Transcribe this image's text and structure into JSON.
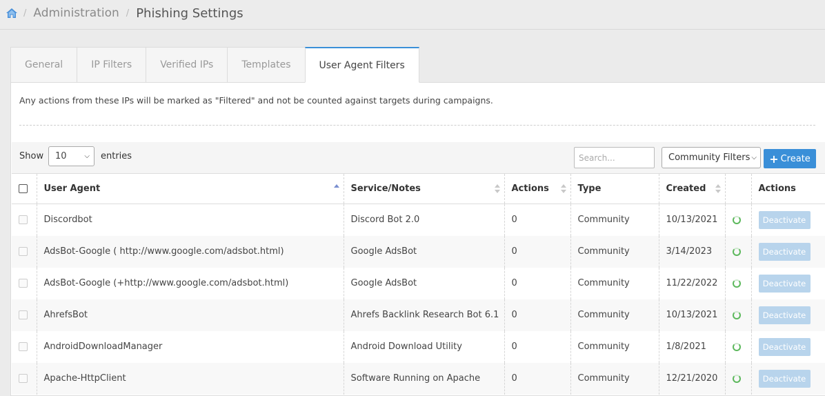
{
  "breadcrumb": {
    "parent": "Administration",
    "title": "Phishing Settings"
  },
  "tabs": [
    {
      "label": "General"
    },
    {
      "label": "IP Filters"
    },
    {
      "label": "Verified IPs"
    },
    {
      "label": "Templates"
    },
    {
      "label": "User Agent Filters",
      "active": true
    }
  ],
  "notice": "Any actions from these IPs will be marked as \"Filtered\" and not be counted against targets during campaigns.",
  "toolbar": {
    "show_label": "Show",
    "entries_value": "10",
    "entries_label": "entries",
    "search_placeholder": "Search...",
    "filter_value": "Community Filters",
    "create_label": "Create"
  },
  "table": {
    "columns": [
      "User Agent",
      "Service/Notes",
      "Actions",
      "Type",
      "Created",
      "",
      "Actions"
    ],
    "rows": [
      {
        "agent": "Discordbot",
        "service": "Discord Bot 2.0",
        "actions": "0",
        "type": "Community",
        "created": "10/13/2021",
        "button": "Deactivate"
      },
      {
        "agent": "AdsBot-Google ( http://www.google.com/adsbot.html)",
        "service": "Google AdsBot",
        "actions": "0",
        "type": "Community",
        "created": "3/14/2023",
        "button": "Deactivate"
      },
      {
        "agent": "AdsBot-Google (+http://www.google.com/adsbot.html)",
        "service": "Google AdsBot",
        "actions": "0",
        "type": "Community",
        "created": "11/22/2022",
        "button": "Deactivate"
      },
      {
        "agent": "AhrefsBot",
        "service": "Ahrefs Backlink Research Bot 6.1",
        "actions": "0",
        "type": "Community",
        "created": "10/13/2021",
        "button": "Deactivate"
      },
      {
        "agent": "AndroidDownloadManager",
        "service": "Android Download Utility",
        "actions": "0",
        "type": "Community",
        "created": "1/8/2021",
        "button": "Deactivate"
      },
      {
        "agent": "Apache-HttpClient",
        "service": "Software Running on Apache",
        "actions": "0",
        "type": "Community",
        "created": "12/21/2020",
        "button": "Deactivate"
      }
    ]
  },
  "colors": {
    "accent": "#3a8fd8",
    "status_green": "#5cb85c",
    "disabled_button": "#b8d4ec"
  }
}
